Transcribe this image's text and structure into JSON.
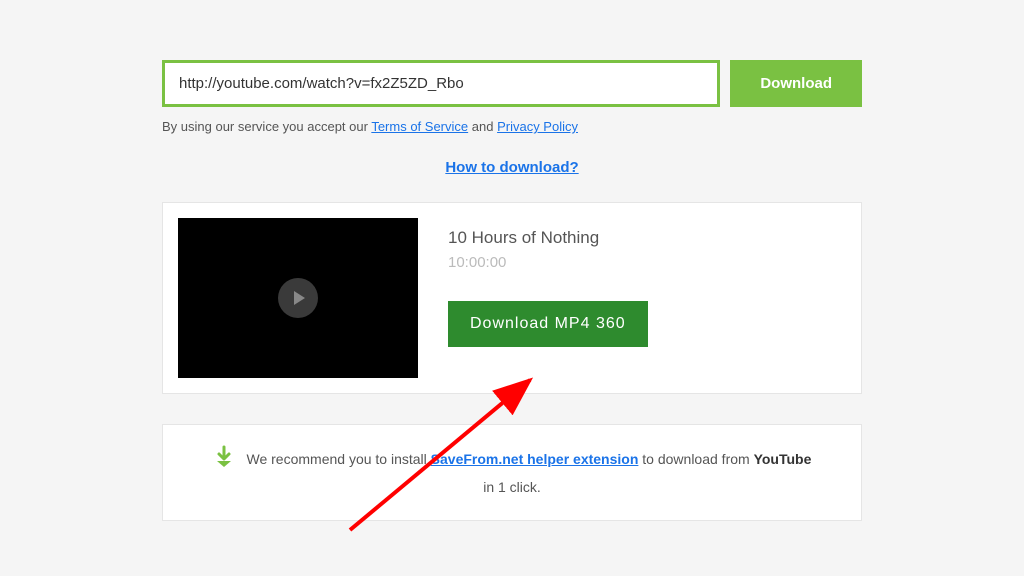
{
  "input": {
    "url": "http://youtube.com/watch?v=fx2Z5ZD_Rbo"
  },
  "buttons": {
    "download": "Download",
    "download_format": "Download  MP4  360"
  },
  "tos": {
    "prefix": "By using our service you accept our ",
    "tos_link": "Terms of Service",
    "mid": " and ",
    "pp_link": "Privacy Policy"
  },
  "howto": "How to download?",
  "video": {
    "title": "10 Hours of Nothing",
    "duration": "10:00:00"
  },
  "recommend": {
    "prefix": "We recommend you to install ",
    "ext_link": "SaveFrom.net helper extension",
    "mid": " to download from ",
    "site": "YouTube",
    "suffix": "in 1 click."
  }
}
